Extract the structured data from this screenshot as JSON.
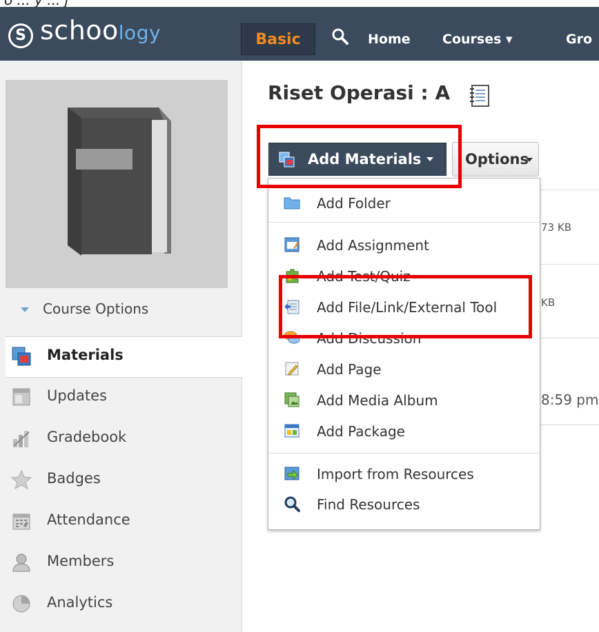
{
  "top_caption": "o ... y ... j",
  "header": {
    "logo_letter": "S",
    "logo_main": "schoo",
    "logo_accent": "logy",
    "basic_label": "Basic",
    "nav": [
      "Home",
      "Courses ▾",
      "Gro"
    ]
  },
  "sidebar": {
    "course_options": "Course Options",
    "items": [
      {
        "label": "Materials",
        "icon": "materials-icon",
        "active": true
      },
      {
        "label": "Updates",
        "icon": "updates-icon"
      },
      {
        "label": "Gradebook",
        "icon": "gradebook-icon"
      },
      {
        "label": "Badges",
        "icon": "badges-icon"
      },
      {
        "label": "Attendance",
        "icon": "attendance-icon"
      },
      {
        "label": "Members",
        "icon": "members-icon"
      },
      {
        "label": "Analytics",
        "icon": "analytics-icon"
      }
    ]
  },
  "main": {
    "title": "Riset Operasi : A",
    "add_materials": "Add Materials",
    "options": "Options",
    "background_fragments": [
      "73 KB",
      "KB",
      "8:59 pm"
    ]
  },
  "dropdown": {
    "items": [
      {
        "label": "Add Folder",
        "icon": "folder-icon"
      },
      {
        "label": "Add Assignment",
        "icon": "assignment-icon"
      },
      {
        "label": "Add Test/Quiz",
        "icon": "quiz-icon"
      },
      {
        "label": "Add File/Link/External Tool",
        "icon": "file-link-icon"
      },
      {
        "label": "Add Discussion",
        "icon": "discussion-icon"
      },
      {
        "label": "Add Page",
        "icon": "page-icon"
      },
      {
        "label": "Add Media Album",
        "icon": "media-album-icon"
      },
      {
        "label": "Add Package",
        "icon": "package-icon"
      },
      {
        "label": "Import from Resources",
        "icon": "import-icon"
      },
      {
        "label": "Find Resources",
        "icon": "find-icon"
      }
    ]
  },
  "colors": {
    "nav_bg": "#3b4a5c",
    "basic_text": "#f08a24",
    "highlight": "#e80000",
    "accent_logo": "#6fb3ea"
  }
}
